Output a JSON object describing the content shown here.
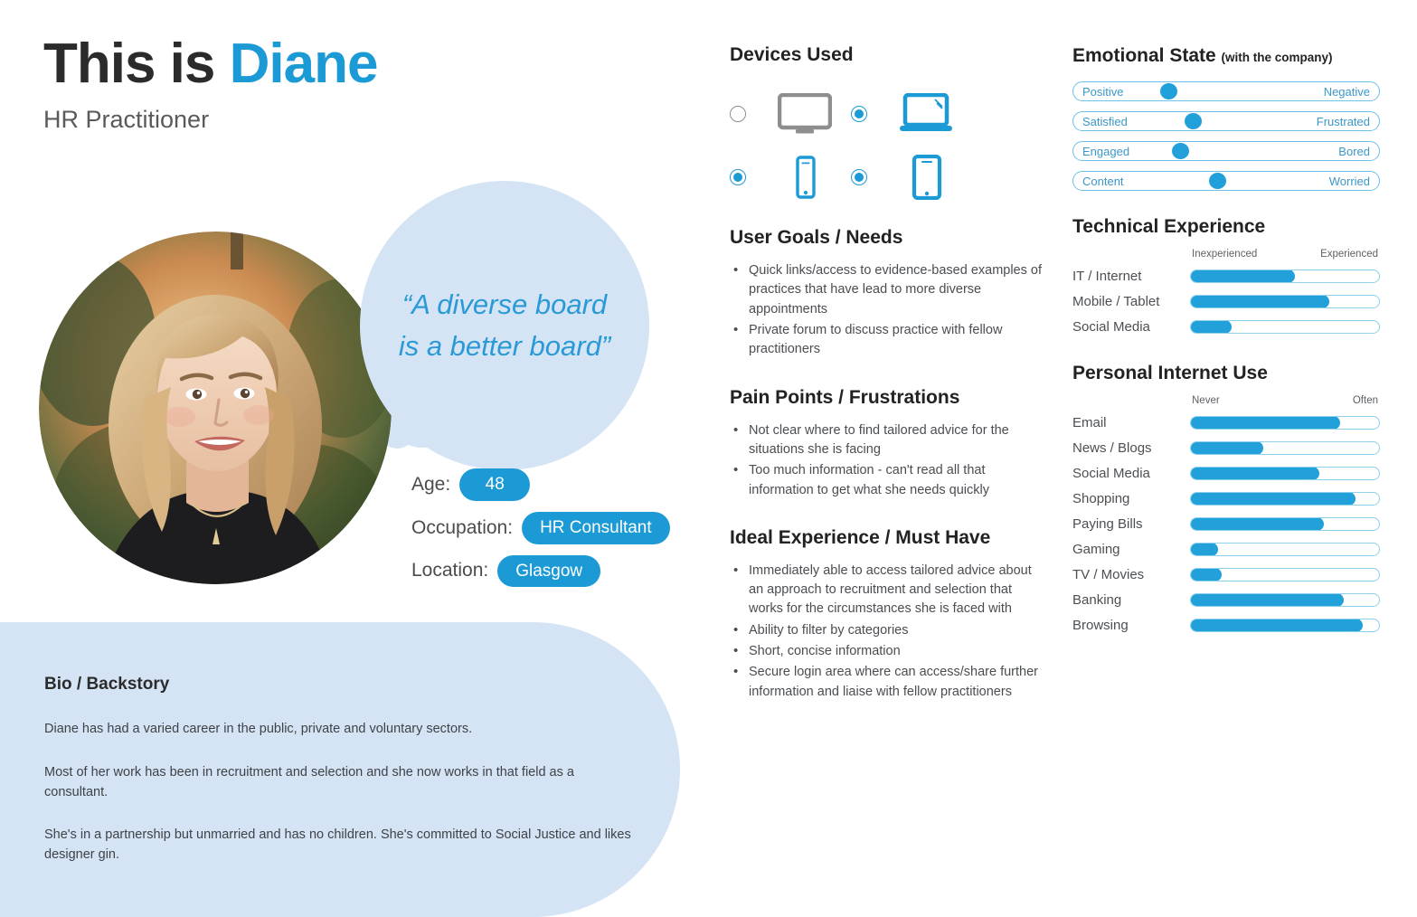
{
  "accent_blue": "#1b9ad6",
  "light_blue_panel": "#d4e4f5",
  "header": {
    "title_prefix": "This is ",
    "title_name": "Diane",
    "subtitle": "HR Practitioner"
  },
  "quote": {
    "text": "“A diverse board is a better board”"
  },
  "attributes": [
    {
      "label": "Age:",
      "value": "48"
    },
    {
      "label": "Occupation:",
      "value": "HR Consultant"
    },
    {
      "label": "Location:",
      "value": "Glasgow"
    }
  ],
  "bio": {
    "title": "Bio / Backstory",
    "paragraphs": [
      "Diane has had a varied career in the public, private and voluntary sectors.",
      "Most of her work has been in recruitment and selection and she now works in that field as a consultant.",
      "She's in a partnership but unmarried and has no children. She's committed to Social Justice and likes designer gin."
    ]
  },
  "devices": {
    "title": "Devices Used",
    "items": [
      {
        "name": "desktop",
        "icon": "desktop-monitor-icon",
        "selected": false
      },
      {
        "name": "laptop",
        "icon": "laptop-icon",
        "selected": true
      },
      {
        "name": "phone",
        "icon": "mobile-phone-icon",
        "selected": true
      },
      {
        "name": "tablet",
        "icon": "tablet-icon",
        "selected": true
      }
    ]
  },
  "goals": {
    "title": "User Goals / Needs",
    "items": [
      "Quick links/access to evidence-based examples of practices that have lead to more diverse appointments",
      "Private forum to discuss practice with fellow practitioners"
    ]
  },
  "pain_points": {
    "title": "Pain Points / Frustrations",
    "items": [
      "Not clear where to find tailored advice for the situations she is facing",
      "Too much information - can't read all that information to get what she needs quickly"
    ]
  },
  "ideal": {
    "title": "Ideal Experience / Must Have",
    "items": [
      "Immediately able to access tailored advice about an approach to recruitment and selection that works for the circumstances she is faced with",
      "Ability to filter by categories",
      "Short, concise information",
      "Secure login area where can access/share further information and liaise with fellow practitioners"
    ]
  },
  "emotional_state": {
    "title": "Emotional State ",
    "subtitle": "(with the company)",
    "rows": [
      {
        "left": "Positive",
        "right": "Negative",
        "position": 31
      },
      {
        "left": "Satisfied",
        "right": "Frustrated",
        "position": 39
      },
      {
        "left": "Engaged",
        "right": "Bored",
        "position": 35
      },
      {
        "left": "Content",
        "right": "Worried",
        "position": 47
      }
    ]
  },
  "technical_experience": {
    "title": "Technical Experience",
    "scale_left": "Inexperienced",
    "scale_right": "Experienced",
    "rows": [
      {
        "label": "IT / Internet",
        "value": 55
      },
      {
        "label": "Mobile / Tablet",
        "value": 73
      },
      {
        "label": "Social Media",
        "value": 21
      }
    ]
  },
  "personal_internet_use": {
    "title": "Personal Internet Use",
    "scale_left": "Never",
    "scale_right": "Often",
    "rows": [
      {
        "label": "Email",
        "value": 79
      },
      {
        "label": "News / Blogs",
        "value": 38
      },
      {
        "label": "Social Media",
        "value": 68
      },
      {
        "label": "Shopping",
        "value": 87
      },
      {
        "label": "Paying Bills",
        "value": 70
      },
      {
        "label": "Gaming",
        "value": 14
      },
      {
        "label": "TV / Movies",
        "value": 16
      },
      {
        "label": "Banking",
        "value": 81
      },
      {
        "label": "Browsing",
        "value": 91
      }
    ]
  },
  "chart_data": [
    {
      "type": "bar",
      "title": "Emotional State (with the company)",
      "categories": [
        "Positive–Negative",
        "Satisfied–Frustrated",
        "Engaged–Bored",
        "Content–Worried"
      ],
      "values": [
        31,
        39,
        35,
        47
      ],
      "xlabel": "",
      "ylabel": "",
      "ylim": [
        0,
        100
      ],
      "legend": "none",
      "grid": false
    },
    {
      "type": "bar",
      "title": "Technical Experience",
      "categories": [
        "IT / Internet",
        "Mobile / Tablet",
        "Social Media"
      ],
      "values": [
        55,
        73,
        21
      ],
      "xlabel": "Inexperienced → Experienced",
      "ylabel": "",
      "ylim": [
        0,
        100
      ],
      "grid": false
    },
    {
      "type": "bar",
      "title": "Personal Internet Use",
      "categories": [
        "Email",
        "News / Blogs",
        "Social Media",
        "Shopping",
        "Paying Bills",
        "Gaming",
        "TV / Movies",
        "Banking",
        "Browsing"
      ],
      "values": [
        79,
        38,
        68,
        87,
        70,
        14,
        16,
        81,
        91
      ],
      "xlabel": "Never → Often",
      "ylabel": "",
      "ylim": [
        0,
        100
      ],
      "grid": false
    }
  ]
}
